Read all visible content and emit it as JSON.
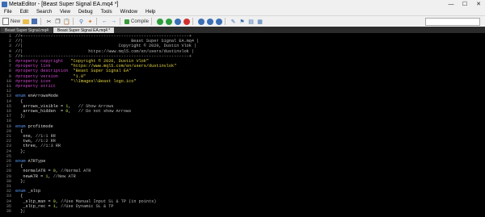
{
  "titlebar": {
    "text": "MetaEditor - [Beast Super Signal EA.mq4 *]"
  },
  "menu": [
    "File",
    "Edit",
    "Search",
    "View",
    "Debug",
    "Tools",
    "Window",
    "Help"
  ],
  "toolbar": {
    "new_label": "New",
    "compile_label": "Compile"
  },
  "tabs": [
    {
      "label": "Beast Super Signal.mq4"
    },
    {
      "label": "Beast Super Signal EA.mq4 *"
    }
  ],
  "editor": {
    "lines": [
      {
        "n": "1",
        "segs": [
          {
            "t": "//+------------------------------------------------------------------+",
            "c": "comment"
          }
        ]
      },
      {
        "n": "2",
        "segs": [
          {
            "t": "//|                                           Beast Super Signal EA.mq4 |",
            "c": "comment"
          }
        ]
      },
      {
        "n": "3",
        "segs": [
          {
            "t": "//|                                      Copyright © 2020, Dustin Vlok |",
            "c": "comment"
          }
        ]
      },
      {
        "n": "4",
        "segs": [
          {
            "t": "//|                          https://www.mql5.com/en/users/dustinvlok |",
            "c": "comment"
          }
        ]
      },
      {
        "n": "5",
        "segs": [
          {
            "t": "//+------------------------------------------------------------------+",
            "c": "comment"
          }
        ]
      },
      {
        "n": "6",
        "segs": [
          {
            "t": "#property copyright   ",
            "c": "prop"
          },
          {
            "t": "\"Copyright © 2020, Dustin Vlok\"",
            "c": "str"
          }
        ]
      },
      {
        "n": "7",
        "segs": [
          {
            "t": "#property link        ",
            "c": "prop"
          },
          {
            "t": "\"https://www.mql5.com/en/users/dustinvlok\"",
            "c": "str"
          }
        ]
      },
      {
        "n": "8",
        "segs": [
          {
            "t": "#property description  ",
            "c": "prop"
          },
          {
            "t": "\"Beast Super Signal EA\"",
            "c": "str"
          }
        ]
      },
      {
        "n": "9",
        "segs": [
          {
            "t": "#property version      ",
            "c": "prop"
          },
          {
            "t": "\"1.0\"",
            "c": "str"
          }
        ]
      },
      {
        "n": "10",
        "segs": [
          {
            "t": "#property icon        ",
            "c": "prop"
          },
          {
            "t": "\"\\\\Images\\\\Beast logo.ico\"",
            "c": "str"
          }
        ]
      },
      {
        "n": "11",
        "segs": [
          {
            "t": "#property strict",
            "c": "prop"
          }
        ]
      },
      {
        "n": "12",
        "segs": []
      },
      {
        "n": "13",
        "segs": [
          {
            "t": "enum ",
            "c": "kw"
          },
          {
            "t": "enArrowsMode",
            "c": "id"
          }
        ]
      },
      {
        "n": "14",
        "segs": [
          {
            "t": "  {",
            "c": "id"
          }
        ]
      },
      {
        "n": "15",
        "segs": [
          {
            "t": "   arrows_visible = ",
            "c": "id"
          },
          {
            "t": "1",
            "c": "num"
          },
          {
            "t": ",   ",
            "c": "id"
          },
          {
            "t": "// Show Arrows",
            "c": "comment"
          }
        ]
      },
      {
        "n": "16",
        "segs": [
          {
            "t": "   arrows_hidden  = ",
            "c": "id"
          },
          {
            "t": "0",
            "c": "num"
          },
          {
            "t": ",   ",
            "c": "id"
          },
          {
            "t": "// Do not show Arrows",
            "c": "comment"
          }
        ]
      },
      {
        "n": "17",
        "segs": [
          {
            "t": "  };",
            "c": "id"
          }
        ]
      },
      {
        "n": "18",
        "segs": []
      },
      {
        "n": "19",
        "segs": [
          {
            "t": "enum ",
            "c": "kw"
          },
          {
            "t": "profitmode",
            "c": "id"
          }
        ]
      },
      {
        "n": "20",
        "segs": [
          {
            "t": "  {",
            "c": "id"
          }
        ]
      },
      {
        "n": "21",
        "segs": [
          {
            "t": "   one, ",
            "c": "id"
          },
          {
            "t": "//1:1 RR",
            "c": "comment"
          }
        ]
      },
      {
        "n": "22",
        "segs": [
          {
            "t": "   two, ",
            "c": "id"
          },
          {
            "t": "//1:2 RR",
            "c": "comment"
          }
        ]
      },
      {
        "n": "23",
        "segs": [
          {
            "t": "   three, ",
            "c": "id"
          },
          {
            "t": "//1:3 RR",
            "c": "comment"
          }
        ]
      },
      {
        "n": "24",
        "segs": [
          {
            "t": "  };",
            "c": "id"
          }
        ]
      },
      {
        "n": "25",
        "segs": []
      },
      {
        "n": "26",
        "segs": [
          {
            "t": "enum ",
            "c": "kw"
          },
          {
            "t": "ATRType",
            "c": "id"
          }
        ]
      },
      {
        "n": "27",
        "segs": [
          {
            "t": "  {",
            "c": "id"
          }
        ]
      },
      {
        "n": "28",
        "segs": [
          {
            "t": "   normalATR = ",
            "c": "id"
          },
          {
            "t": "0",
            "c": "num"
          },
          {
            "t": ", ",
            "c": "id"
          },
          {
            "t": "//Normal ATR",
            "c": "comment"
          }
        ]
      },
      {
        "n": "29",
        "segs": [
          {
            "t": "   newATR = ",
            "c": "id"
          },
          {
            "t": "1",
            "c": "num"
          },
          {
            "t": ", ",
            "c": "id"
          },
          {
            "t": "//New ATR",
            "c": "comment"
          }
        ]
      },
      {
        "n": "30",
        "segs": [
          {
            "t": "  };",
            "c": "id"
          }
        ]
      },
      {
        "n": "31",
        "segs": []
      },
      {
        "n": "32",
        "segs": [
          {
            "t": "enum ",
            "c": "kw"
          },
          {
            "t": "_sltp",
            "c": "id"
          }
        ]
      },
      {
        "n": "33",
        "segs": [
          {
            "t": "  {",
            "c": "id"
          }
        ]
      },
      {
        "n": "34",
        "segs": [
          {
            "t": "   _sltp_man = ",
            "c": "id"
          },
          {
            "t": "0",
            "c": "num"
          },
          {
            "t": ", ",
            "c": "id"
          },
          {
            "t": "//Use Manual Input SL & TP (in points)",
            "c": "comment"
          }
        ]
      },
      {
        "n": "35",
        "segs": [
          {
            "t": "   _sltp_rec = ",
            "c": "id"
          },
          {
            "t": "1",
            "c": "num"
          },
          {
            "t": ", ",
            "c": "id"
          },
          {
            "t": "//Use Dynamic SL & TP",
            "c": "comment"
          }
        ]
      },
      {
        "n": "36",
        "segs": [
          {
            "t": "  };",
            "c": "id"
          }
        ]
      }
    ]
  },
  "colors": {
    "comment": "#b8b8b8",
    "prop": "#d04ad0",
    "str": "#e0d040",
    "kw": "#5aa0ff",
    "id": "#d8d8d8",
    "num": "#b0e050",
    "editor_bg": "#000000"
  },
  "icons": [
    "app-icon",
    "new-icon",
    "open-icon",
    "save-icon",
    "cut-icon",
    "copy-icon",
    "paste-icon",
    "undo-icon",
    "redo-icon",
    "compile-icon",
    "start-icon",
    "pause-icon",
    "stop-icon"
  ]
}
